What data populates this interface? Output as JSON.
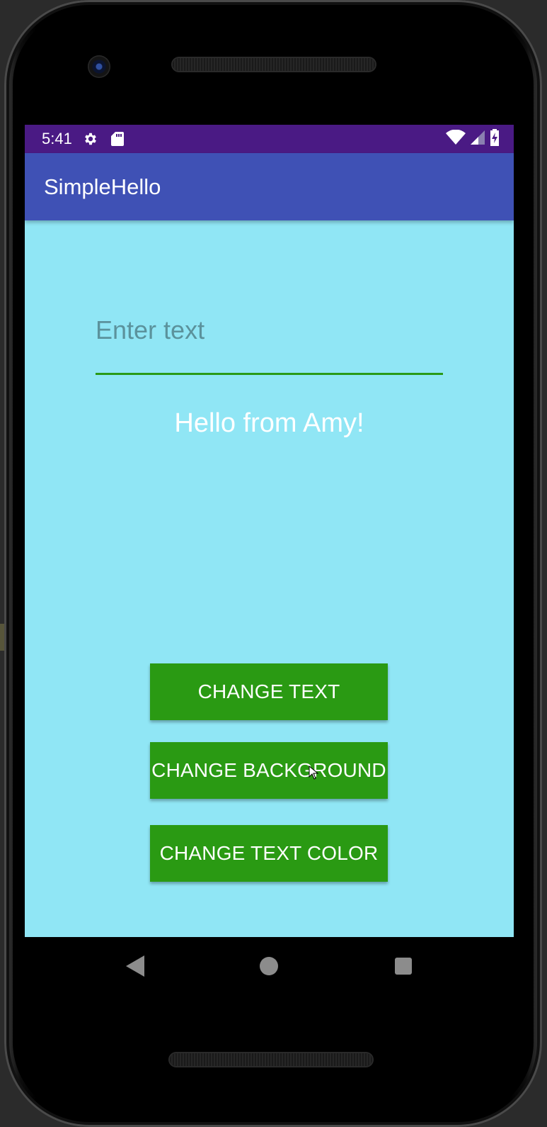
{
  "status_bar": {
    "time": "5:41",
    "left_icons": [
      "settings-icon",
      "sd-card-icon"
    ],
    "right_icons": [
      "wifi-icon",
      "cell-signal-icon",
      "battery-charging-icon"
    ],
    "color": "#4a1a84"
  },
  "app_bar": {
    "title": "SimpleHello",
    "color": "#3f51b5"
  },
  "main": {
    "background_color": "#90e6f5",
    "input": {
      "placeholder": "Enter text",
      "value": ""
    },
    "greeting": "Hello from Amy!",
    "buttons": [
      {
        "label": "CHANGE TEXT"
      },
      {
        "label": "CHANGE BACKGROUND"
      },
      {
        "label": "CHANGE TEXT COLOR"
      }
    ],
    "button_color": "#2a9a13"
  },
  "nav_bar": {
    "icons": [
      "back-icon",
      "home-icon",
      "recents-icon"
    ]
  }
}
